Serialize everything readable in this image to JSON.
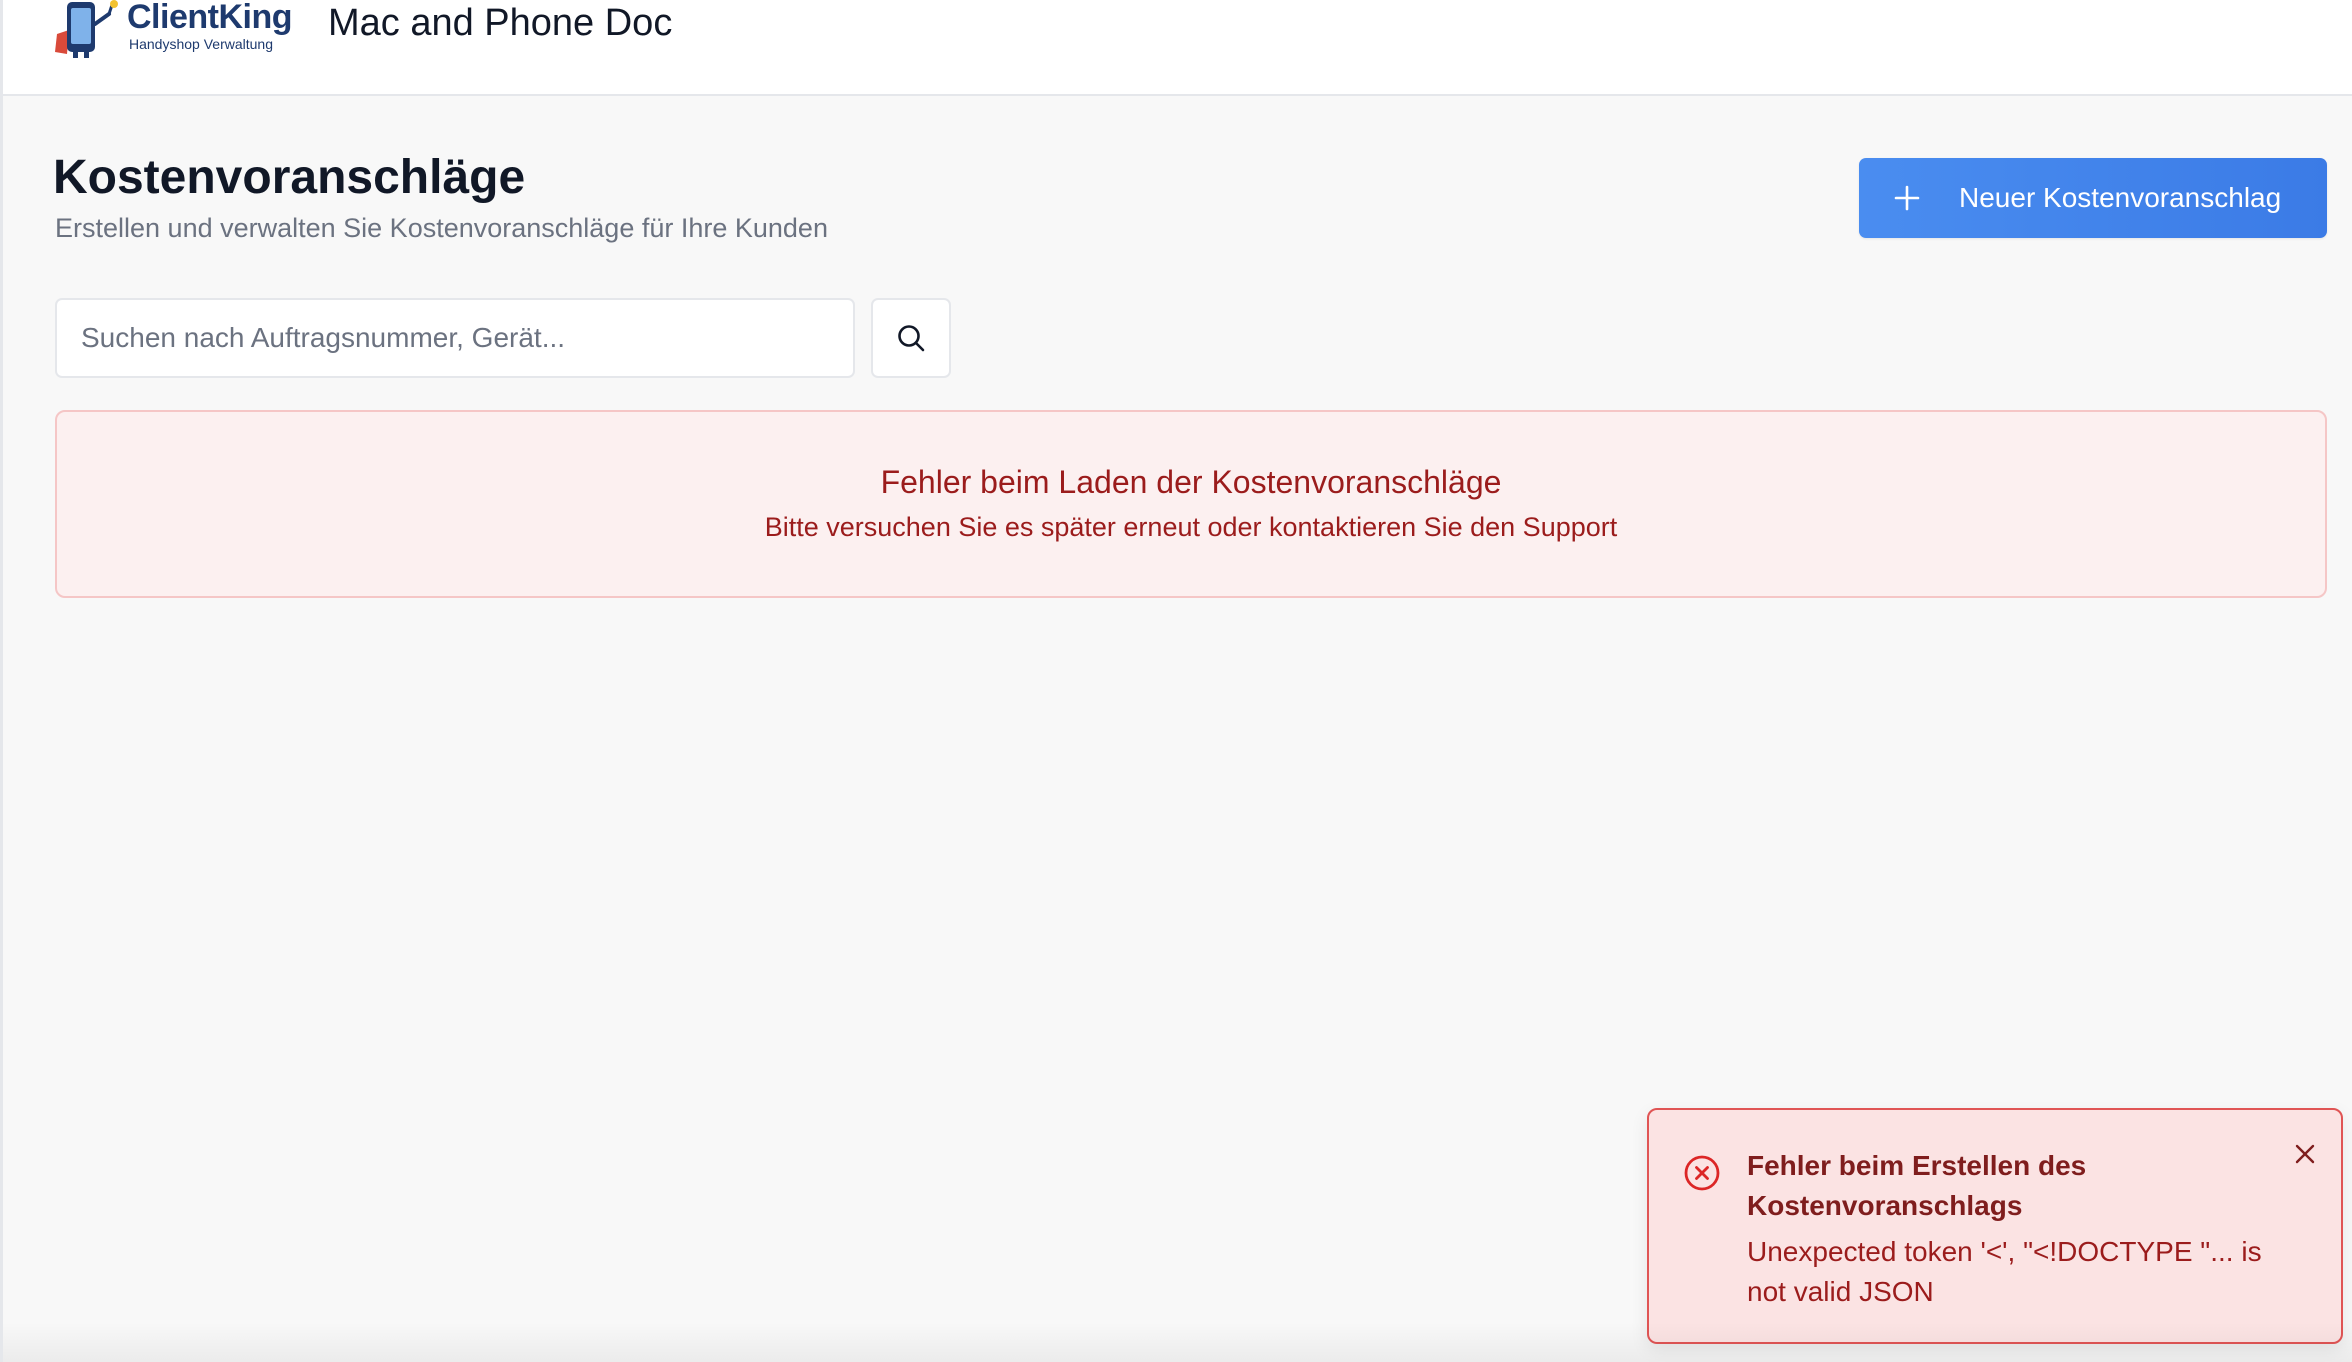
{
  "header": {
    "logo_name": "ClientKing",
    "logo_subtitle": "Handyshop Verwaltung",
    "shop_name": "Mac and Phone Doc"
  },
  "page": {
    "title": "Kostenvoranschläge",
    "subtitle": "Erstellen und verwalten Sie Kostenvoranschläge für Ihre Kunden",
    "new_button_label": "Neuer Kostenvoranschlag"
  },
  "search": {
    "placeholder": "Suchen nach Auftragsnummer, Gerät...",
    "value": ""
  },
  "error_panel": {
    "title": "Fehler beim Laden der Kostenvoranschläge",
    "text": "Bitte versuchen Sie es später erneut oder kontaktieren Sie den Support"
  },
  "toast": {
    "title": "Fehler beim Erstellen des Kostenvoranschlags",
    "message": "Unexpected token '<', \"<!DOCTYPE \"... is not valid JSON"
  },
  "colors": {
    "primary": "#3b82f6",
    "error_text": "#9b1c1c",
    "error_bg": "#fcf0f0",
    "toast_border": "#e05454",
    "logo_blue": "#1e3a6e"
  },
  "icons": {
    "logo": "clientking-mascot-icon",
    "new": "plus-icon",
    "search": "search-icon",
    "toast": "x-circle-icon",
    "close": "close-icon"
  }
}
